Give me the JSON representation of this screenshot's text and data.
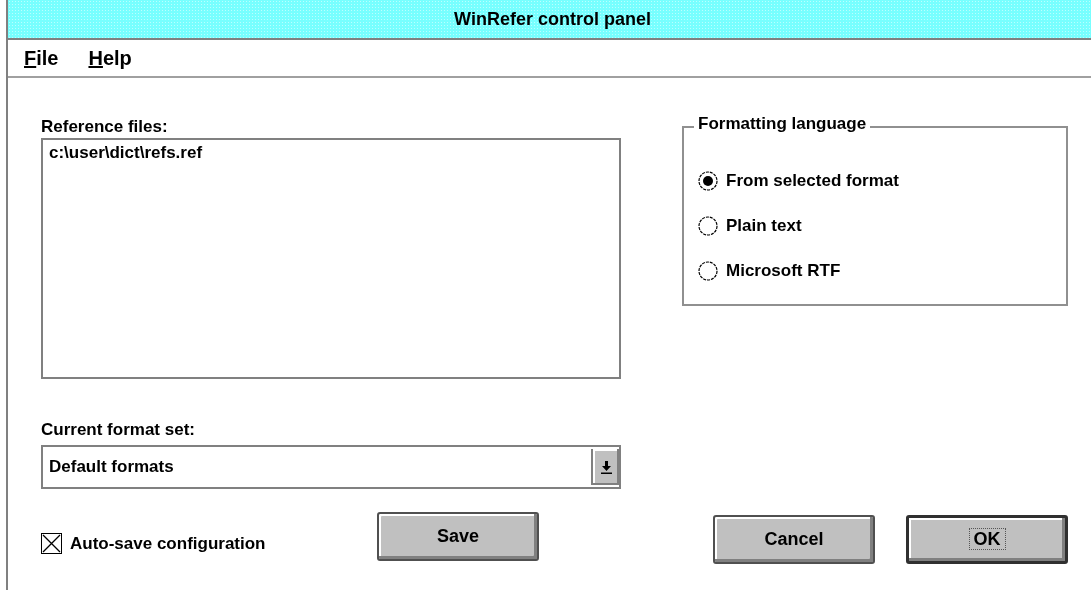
{
  "window": {
    "title": "WinRefer control panel"
  },
  "menu": [
    {
      "label": "File"
    },
    {
      "label": "Help"
    }
  ],
  "reference_files": {
    "label": "Reference files:",
    "items": [
      {
        "text": "c:\\user\\dict\\refs.ref",
        "selected": false
      }
    ]
  },
  "format_set": {
    "label": "Current format set:",
    "value": "Default formats"
  },
  "formatting_language": {
    "title": "Formatting language",
    "options": [
      {
        "label": "From selected format",
        "selected": true
      },
      {
        "label": "Plain text",
        "selected": false
      },
      {
        "label": "Microsoft RTF",
        "selected": false
      }
    ]
  },
  "auto_save": {
    "label": "Auto-save configuration",
    "checked": true
  },
  "buttons": [
    {
      "label": "Save",
      "focused": false
    },
    {
      "label": "Cancel",
      "focused": false
    },
    {
      "label": "OK",
      "focused": true
    }
  ]
}
